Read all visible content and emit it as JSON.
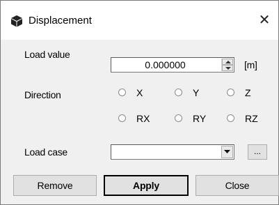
{
  "window": {
    "title": "Displacement",
    "close_glyph": "✕",
    "app_icon": "cube-icon"
  },
  "load_value": {
    "label": "Load value",
    "value": "0.000000",
    "unit": "[m]"
  },
  "direction": {
    "label": "Direction",
    "options": [
      {
        "label": "X",
        "selected": false
      },
      {
        "label": "Y",
        "selected": false
      },
      {
        "label": "Z",
        "selected": false
      },
      {
        "label": "RX",
        "selected": false
      },
      {
        "label": "RY",
        "selected": false
      },
      {
        "label": "RZ",
        "selected": false
      }
    ]
  },
  "load_case": {
    "label": "Load case",
    "value": "",
    "browse_label": "..."
  },
  "buttons": {
    "remove": "Remove",
    "apply": "Apply",
    "close": "Close"
  }
}
